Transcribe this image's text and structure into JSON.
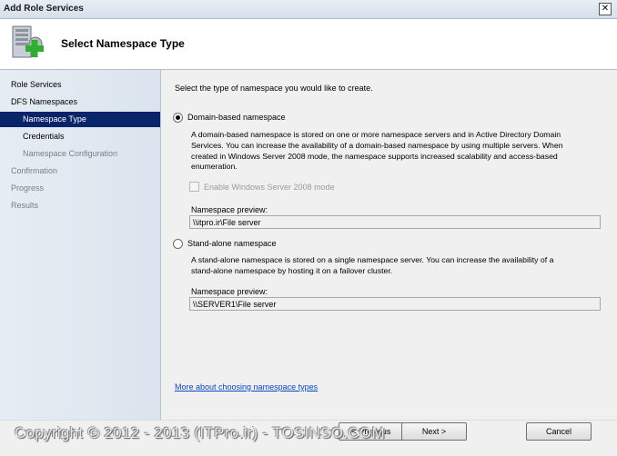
{
  "window": {
    "title": "Add Role Services",
    "close_symbol": "✕"
  },
  "header": {
    "title": "Select Namespace Type",
    "icon": "server-add-icon"
  },
  "sidebar": {
    "items": [
      {
        "label": "Role Services"
      },
      {
        "label": "DFS Namespaces"
      },
      {
        "label": "Namespace Type"
      },
      {
        "label": "Credentials"
      },
      {
        "label": "Namespace Configuration"
      },
      {
        "label": "Confirmation"
      },
      {
        "label": "Progress"
      },
      {
        "label": "Results"
      }
    ]
  },
  "main": {
    "instruction": "Select the type of namespace you would like to create.",
    "domain_option": {
      "label": "Domain-based namespace",
      "desc_lines": [
        "A domain-based namespace is stored on one or more namespace servers and in Active Directory Domain",
        "Services. You can increase the availability of a domain-based namespace by using multiple servers. When",
        "created in Windows Server 2008 mode, the namespace supports increased scalability and access-based",
        "enumeration."
      ],
      "checkbox_label": "Enable Windows Server 2008 mode",
      "preview_label": "Namespace preview:",
      "preview_value": "\\\\itpro.ir\\File server"
    },
    "standalone_option": {
      "label": "Stand-alone namespace",
      "desc_lines": [
        "A stand-alone namespace is stored on a single namespace server. You can increase the availability of a",
        "stand-alone namespace by hosting it on a failover cluster."
      ],
      "preview_label": "Namespace preview:",
      "preview_value": "\\\\SERVER1\\File server"
    },
    "help_link": "More about choosing namespace types"
  },
  "footer": {
    "watermark": "Copyright © 2012 - 2013 (ITPro.ir) - TOSINSO.COM",
    "previous_label": "< Previous",
    "next_label": "Next >",
    "cancel_label": "Cancel"
  },
  "colors": {
    "selection": "#0a246a",
    "link": "#0a46c8",
    "disabled": "#9a9a9a"
  }
}
